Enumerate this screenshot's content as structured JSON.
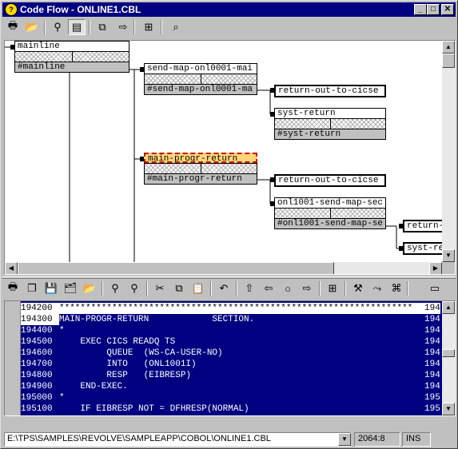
{
  "window": {
    "title": "Code Flow - ONLINE1.CBL",
    "controls": {
      "minimize": "_",
      "maximize": "□",
      "close": "✕"
    }
  },
  "flow_toolbar": [
    {
      "name": "print-icon",
      "glyph": "🖶",
      "pressed": false
    },
    {
      "name": "open-icon",
      "glyph": "📂",
      "pressed": false
    },
    {
      "name": "find-icon",
      "glyph": "⚲",
      "pressed": false
    },
    {
      "name": "view-icon",
      "glyph": "▤",
      "pressed": true
    },
    {
      "name": "copy-icon",
      "glyph": "⧉",
      "pressed": false
    },
    {
      "name": "forward-icon",
      "glyph": "⇨",
      "pressed": false
    },
    {
      "name": "properties-icon",
      "glyph": "⊞",
      "pressed": false
    },
    {
      "name": "search-icon",
      "glyph": "⌕",
      "pressed": false
    }
  ],
  "flow": {
    "nodes": [
      {
        "id": "n1",
        "name": "mainline",
        "label": "#mainline",
        "single": false,
        "selected": false
      },
      {
        "id": "n2",
        "name": "send-map-onl0001-mai",
        "label": "#send-map-onl0001-ma",
        "single": false,
        "selected": false
      },
      {
        "id": "n3",
        "name": "return-out-to-cicse",
        "label": "",
        "single": true,
        "selected": false
      },
      {
        "id": "n4",
        "name": "syst-return",
        "label": "#syst-return",
        "single": false,
        "selected": false
      },
      {
        "id": "n5",
        "name": "main-progr-return",
        "label": "#main-progr-return",
        "single": false,
        "selected": true
      },
      {
        "id": "n6",
        "name": "return-out-to-cicse",
        "label": "",
        "single": true,
        "selected": false
      },
      {
        "id": "n7",
        "name": "onl1001-send-map-sec",
        "label": "#onl1001-send-map-se",
        "single": false,
        "selected": false
      },
      {
        "id": "n8",
        "name": "return-",
        "label": "",
        "single": true,
        "selected": false
      },
      {
        "id": "n9",
        "name": "syst-re",
        "label": "",
        "single": true,
        "selected": false
      }
    ]
  },
  "code_toolbar": [
    {
      "name": "print-icon",
      "glyph": "🖶"
    },
    {
      "name": "copy-pages-icon",
      "glyph": "❐"
    },
    {
      "name": "save-icon",
      "glyph": "💾"
    },
    {
      "name": "save-all-icon",
      "glyph": "🗂"
    },
    {
      "name": "open-folder-icon",
      "glyph": "📂"
    },
    {
      "name": "find-icon",
      "glyph": "⚲"
    },
    {
      "name": "find-next-icon",
      "glyph": "⚲"
    },
    {
      "name": "cut-icon",
      "glyph": "✂"
    },
    {
      "name": "copy-icon",
      "glyph": "⧉"
    },
    {
      "name": "paste-icon",
      "glyph": "📋"
    },
    {
      "name": "undo-icon",
      "glyph": "↶"
    },
    {
      "name": "up-icon",
      "glyph": "⇧"
    },
    {
      "name": "back-icon",
      "glyph": "⇦"
    },
    {
      "name": "stop-icon",
      "glyph": "○"
    },
    {
      "name": "next-icon",
      "glyph": "⇨"
    },
    {
      "name": "properties-icon",
      "glyph": "⊞"
    },
    {
      "name": "tool-icon",
      "glyph": "⚒"
    },
    {
      "name": "flow-icon",
      "glyph": "⤳"
    },
    {
      "name": "network-icon",
      "glyph": "⌘"
    },
    {
      "name": "window-icon",
      "glyph": "▭"
    }
  ],
  "code": {
    "lines": [
      {
        "num": "194200",
        "text": "*******************************************************************",
        "seq": "194",
        "selected": false
      },
      {
        "num": "194300",
        "text": "MAIN-PROGR-RETURN            SECTION.",
        "seq": "194",
        "selected": true
      },
      {
        "num": "194400",
        "text": "*",
        "seq": "194",
        "selected": true
      },
      {
        "num": "194500",
        "text": "    EXEC CICS READQ TS",
        "seq": "194",
        "selected": true
      },
      {
        "num": "194600",
        "text": "         QUEUE  (WS-CA-USER-NO)",
        "seq": "194",
        "selected": true
      },
      {
        "num": "194700",
        "text": "         INTO   (ONL1001I)",
        "seq": "194",
        "selected": true
      },
      {
        "num": "194800",
        "text": "         RESP   (EIBRESP)",
        "seq": "194",
        "selected": true
      },
      {
        "num": "194900",
        "text": "    END-EXEC.",
        "seq": "194",
        "selected": true
      },
      {
        "num": "195000",
        "text": "*",
        "seq": "195",
        "selected": true
      },
      {
        "num": "195100",
        "text": "    IF EIBRESP NOT = DFHRESP(NORMAL)",
        "seq": "195",
        "selected": true
      }
    ]
  },
  "status": {
    "path": "E:\\TPS\\SAMPLES\\REVOLVE\\SAMPLEAPP\\COBOL\\ONLINE1.CBL",
    "position": "2064:8",
    "mode": "INS"
  }
}
